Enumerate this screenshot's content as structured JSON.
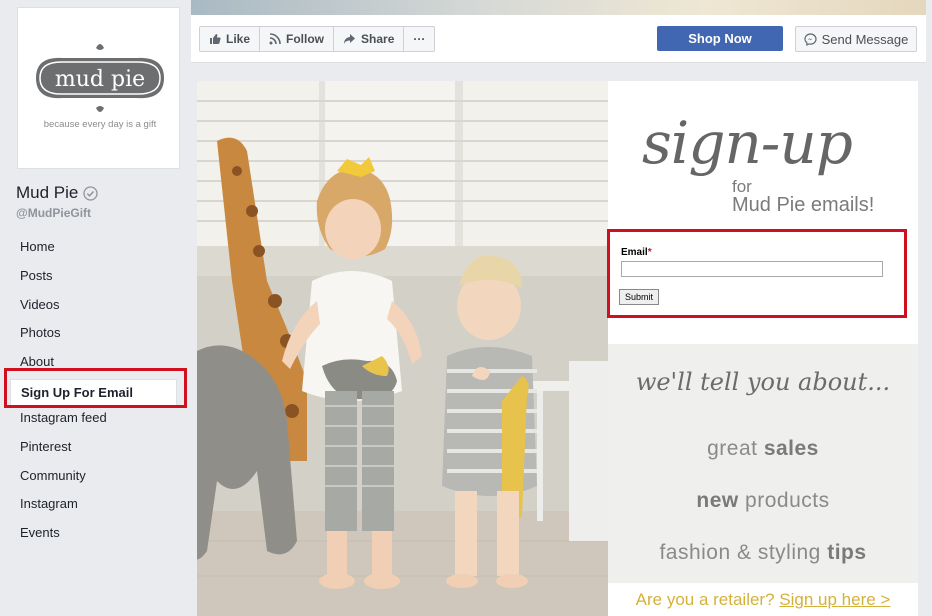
{
  "action_bar": {
    "like_label": "Like",
    "follow_label": "Follow",
    "share_label": "Share",
    "more_label": "···",
    "shop_now_label": "Shop Now",
    "send_message_label": "Send Message"
  },
  "sidebar": {
    "logo_word": "mudpie",
    "logo_tagline": "because every day is a gift",
    "page_name": "Mud Pie",
    "handle": "@MudPieGift",
    "items": [
      {
        "label": "Home"
      },
      {
        "label": "Posts"
      },
      {
        "label": "Videos"
      },
      {
        "label": "Photos"
      },
      {
        "label": "About"
      },
      {
        "label": "Sign Up For Email"
      },
      {
        "label": "Instagram feed"
      },
      {
        "label": "Pinterest"
      },
      {
        "label": "Community"
      },
      {
        "label": "Instagram"
      },
      {
        "label": "Events"
      }
    ],
    "active_item": "Sign Up For Email"
  },
  "signup": {
    "script_title": "sign-up",
    "for_text": "for",
    "emails_text": "Mud Pie emails!",
    "email_label": "Email",
    "required_mark": "*",
    "email_value": "",
    "submit_label": "Submit",
    "tell_script": "we'll tell you about...",
    "line1_regular": "great ",
    "line1_bold": "sales",
    "line2_bold": "new",
    "line2_regular": " products",
    "line3_regular": "fashion & styling ",
    "line3_bold": "tips",
    "retailer_text": "Are you a retailer? ",
    "retailer_link": "Sign up here >"
  },
  "colors": {
    "facebook_blue": "#4267b2",
    "highlight_red": "#d0101e",
    "retail_gold": "#d4b23a"
  }
}
